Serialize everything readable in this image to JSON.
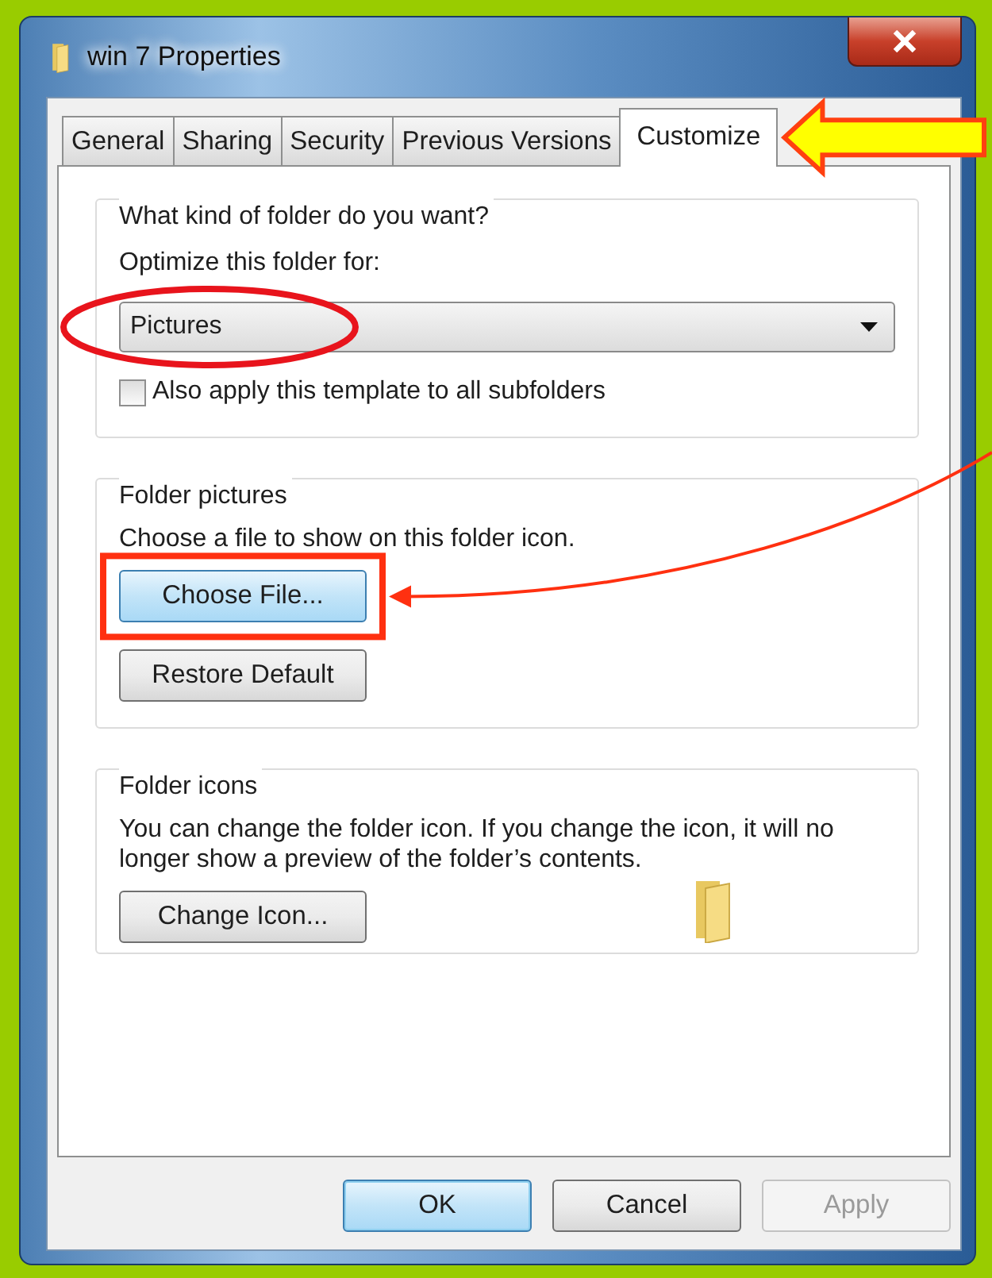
{
  "window": {
    "title": "win 7 Properties"
  },
  "tabs": [
    {
      "label": "General",
      "selected": false
    },
    {
      "label": "Sharing",
      "selected": false
    },
    {
      "label": "Security",
      "selected": false
    },
    {
      "label": "Previous Versions",
      "selected": false
    },
    {
      "label": "Customize",
      "selected": true
    }
  ],
  "groups": [
    {
      "kind": "template",
      "title": "What kind of folder do you want?",
      "label": "Optimize this folder for:",
      "dropdown": {
        "value": "Pictures"
      },
      "checkbox": {
        "label": "Also apply this template to all subfolders",
        "checked": false
      }
    },
    {
      "kind": "pictures",
      "title": "Folder pictures",
      "text": "Choose a file to show on this folder icon.",
      "buttons": [
        {
          "label": "Choose File...",
          "focused": true
        },
        {
          "label": "Restore Default",
          "focused": false
        }
      ]
    },
    {
      "kind": "icons",
      "title": "Folder icons",
      "text": "You can change the folder icon. If you change the icon, it will no longer show a preview of the folder’s contents.",
      "buttons": [
        {
          "label": "Change Icon...",
          "focused": false
        }
      ]
    }
  ],
  "dialog_buttons": [
    {
      "label": "OK",
      "default": true,
      "disabled": false
    },
    {
      "label": "Cancel",
      "default": false,
      "disabled": false
    },
    {
      "label": "Apply",
      "default": false,
      "disabled": true
    }
  ],
  "annotations": [
    {
      "kind": "ellipse"
    },
    {
      "kind": "block-arrow"
    },
    {
      "kind": "rectangle"
    },
    {
      "kind": "curved-arrow"
    }
  ]
}
